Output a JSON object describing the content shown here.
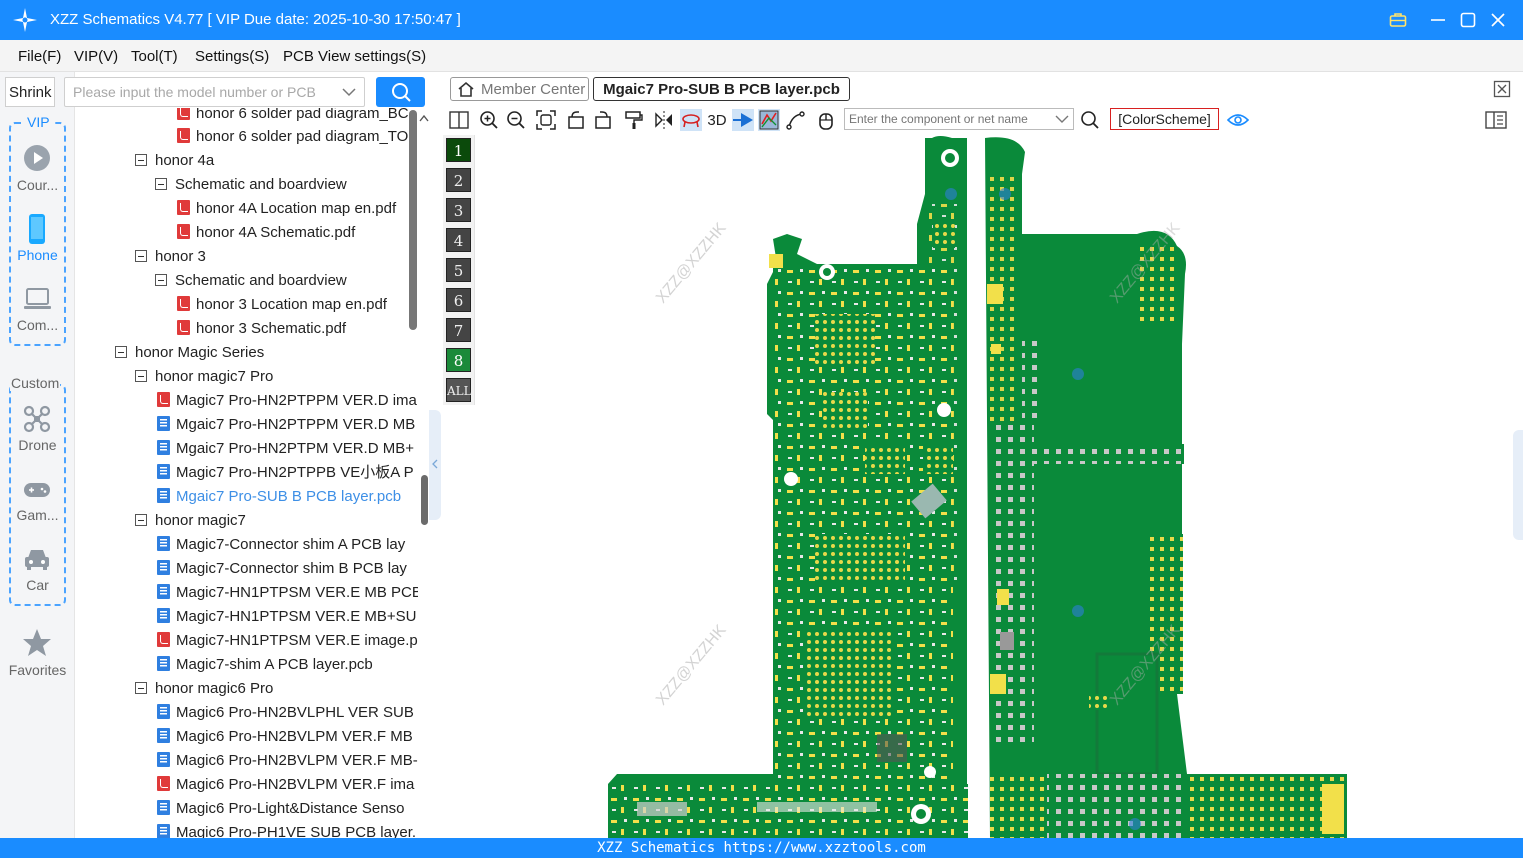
{
  "window": {
    "title": "XZZ Schematics V4.77 [ VIP Due date: 2025-10-30 17:50:47 ]"
  },
  "menu": [
    "File(F)",
    "VIP(V)",
    "Tool(T)",
    "Settings(S)",
    "PCB View settings(S)"
  ],
  "sidebar": {
    "shrink_label": "Shrink",
    "search_placeholder": "Please input the model number or PCB",
    "vip_group_label": "VIP",
    "custom_group_label": "Custom",
    "items": [
      {
        "label": "Cour...",
        "icon": "play-circle-icon"
      },
      {
        "label": "Phone",
        "icon": "phone-icon",
        "active": true
      },
      {
        "label": "Com...",
        "icon": "laptop-icon"
      },
      {
        "label": "Drone",
        "icon": "drone-icon"
      },
      {
        "label": "Gam...",
        "icon": "gamepad-icon"
      },
      {
        "label": "Car",
        "icon": "car-icon"
      },
      {
        "label": "Favorites",
        "icon": "star-icon"
      }
    ]
  },
  "tree": [
    {
      "label": "honor 6 solder pad diagram_BC",
      "type": "pdf"
    },
    {
      "label": "honor 6 solder pad diagram_TO",
      "type": "pdf"
    },
    {
      "label": "honor 4a",
      "type": "folder"
    },
    {
      "label": "Schematic and boardview",
      "type": "folder"
    },
    {
      "label": "honor 4A Location map en.pdf",
      "type": "pdf"
    },
    {
      "label": "honor 4A Schematic.pdf",
      "type": "pdf"
    },
    {
      "label": "honor 3",
      "type": "folder"
    },
    {
      "label": "Schematic and boardview",
      "type": "folder"
    },
    {
      "label": "honor 3 Location map en.pdf",
      "type": "pdf"
    },
    {
      "label": "honor 3 Schematic.pdf",
      "type": "pdf"
    },
    {
      "label": "honor Magic Series",
      "type": "folder"
    },
    {
      "label": "honor magic7 Pro",
      "type": "folder"
    },
    {
      "label": "Magic7 Pro-HN2PTPPM VER.D ima",
      "type": "pdf"
    },
    {
      "label": "Mgaic7 Pro-HN2PTPPM VER.D MB I",
      "type": "pcb"
    },
    {
      "label": "Mgaic7 Pro-HN2PTPM VER.D MB+",
      "type": "pcb"
    },
    {
      "label": "Magic7 Pro-HN2PTPPB VE小板A P",
      "type": "pcb"
    },
    {
      "label": "Mgaic7 Pro-SUB B PCB layer.pcb",
      "type": "pcb",
      "selected": true
    },
    {
      "label": "honor magic7",
      "type": "folder"
    },
    {
      "label": "Magic7-Connector shim A PCB lay",
      "type": "pcb"
    },
    {
      "label": "Magic7-Connector shim B PCB lay",
      "type": "pcb"
    },
    {
      "label": "Magic7-HN1PTPSM VER.E MB PCB",
      "type": "pcb"
    },
    {
      "label": "Magic7-HN1PTPSM VER.E MB+SU",
      "type": "pcb"
    },
    {
      "label": "Magic7-HN1PTPSM VER.E image.p",
      "type": "pdf"
    },
    {
      "label": "Magic7-shim A PCB layer.pcb",
      "type": "pcb"
    },
    {
      "label": "honor magic6 Pro",
      "type": "folder"
    },
    {
      "label": "Magic6 Pro-HN2BVLPHL VER SUB",
      "type": "pcb"
    },
    {
      "label": "Magic6 Pro-HN2BVLPM VER.F MB",
      "type": "pcb"
    },
    {
      "label": "Magic6 Pro-HN2BVLPM VER.F MB-",
      "type": "pcb"
    },
    {
      "label": "Magic6 Pro-HN2BVLPM VER.F ima",
      "type": "pdf"
    },
    {
      "label": "Magic6 Pro-Light&Distance Senso",
      "type": "pcb"
    },
    {
      "label": "Magic6 Pro-PH1VE SUB PCB layer.",
      "type": "pcb"
    }
  ],
  "tabs": {
    "member_center": "Member Center",
    "active_file": "Mgaic7 Pro-SUB B PCB layer.pcb"
  },
  "toolbar": {
    "label_3d": "3D",
    "component_placeholder": "Enter the component or net name",
    "colorscheme_label": "[ColorScheme]"
  },
  "layers": [
    "1",
    "2",
    "3",
    "4",
    "5",
    "6",
    "7",
    "8",
    "ALL"
  ],
  "watermark": "XZZ@XZZHK",
  "status": {
    "text": "XZZ Schematics https://www.xzztools.com"
  },
  "colors": {
    "accent": "#1a8cff",
    "pcb_green": "#0a8a3a",
    "pad_yellow": "#f2e04a"
  }
}
